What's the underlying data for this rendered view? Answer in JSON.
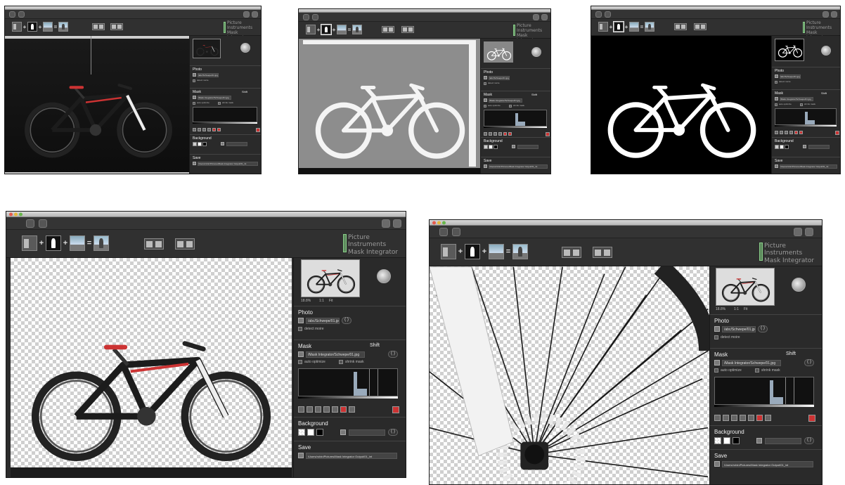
{
  "app": {
    "brand_line1": "Picture Instruments",
    "brand_line2": "Mask Integrator"
  },
  "panel": {
    "preview_zoom": "18.8%",
    "preview_fit_1": "1:1",
    "preview_fit_2": "Fit",
    "photo_title": "Photo",
    "photo_file": "/abc/Schwepe/01.jpg",
    "detect_moire_label": "detect moire",
    "mask_title": "Mask",
    "shift_label": "Shift",
    "mask_file": "/Mask Integrator/Schwepe/01.jpg",
    "auto_optimize_label": "auto optimize",
    "shrink_mask_label": "shrink mask",
    "background_title": "Background",
    "save_title": "Save",
    "save_path": "/Users/robin/Pictures/Mask Integrator Output/01_int",
    "paren_btn": "( )"
  },
  "icons": {
    "toolbar_left_1": "refresh-icon",
    "toolbar_left_2": "settings-icon",
    "toolbar_right_1": "info-icon",
    "toolbar_right_2": "wrench-icon",
    "recipe_plus": "+",
    "recipe_equals": "="
  },
  "colors": {
    "window_bg": "#2b2b2b",
    "accent_red": "#cc3333",
    "brand_green": "#5c8a5c"
  },
  "windows": [
    {
      "id": "w1",
      "canvas_mode": "dark photo"
    },
    {
      "id": "w2",
      "canvas_mode": "raw mask"
    },
    {
      "id": "w3",
      "canvas_mode": "optimized mask"
    },
    {
      "id": "w4",
      "canvas_mode": "transparent result"
    },
    {
      "id": "w5",
      "canvas_mode": "zoomed result"
    }
  ]
}
